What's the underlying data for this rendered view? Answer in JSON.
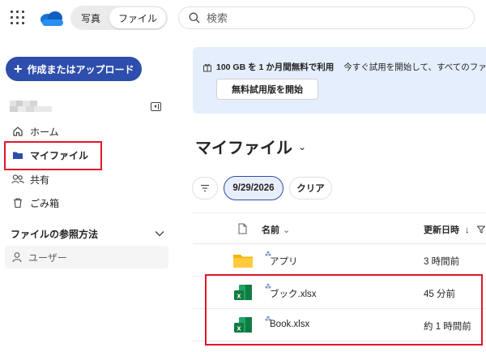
{
  "header": {
    "switch": {
      "photos": "写真",
      "files": "ファイル"
    },
    "search_placeholder": "検索"
  },
  "sidebar": {
    "create_label": "作成またはアップロード",
    "nav": [
      {
        "label": "ホーム",
        "icon": "home-icon"
      },
      {
        "label": "マイファイル",
        "icon": "folder-icon",
        "selected": true
      },
      {
        "label": "共有",
        "icon": "people-icon"
      },
      {
        "label": "ごみ箱",
        "icon": "trash-icon"
      }
    ],
    "browse_header": "ファイルの参照方法",
    "browse_items": [
      {
        "label": "ユーザー",
        "icon": "person-icon"
      }
    ]
  },
  "banner": {
    "bold_text": "100 GB を 1 か月間無料で利用",
    "text": "今すぐ試用を開始して、すべてのファイル",
    "button": "無料試用版を開始"
  },
  "main": {
    "title": "マイファイル",
    "filters": {
      "date": "9/29/2026",
      "clear": "クリア"
    },
    "columns": {
      "name": "名前",
      "updated": "更新日時"
    },
    "rows": [
      {
        "name": "アプリ",
        "type": "folder",
        "updated": "3 時間前"
      },
      {
        "name": "ブック.xlsx",
        "type": "excel",
        "updated": "45 分前"
      },
      {
        "name": "Book.xlsx",
        "type": "excel",
        "updated": "約 1 時間前"
      }
    ]
  },
  "colors": {
    "accent": "#2d4eac",
    "highlight_box": "#e0182b",
    "banner_bg": "#e5eefc",
    "folder": "#f5b400",
    "excel": "#107c41"
  }
}
